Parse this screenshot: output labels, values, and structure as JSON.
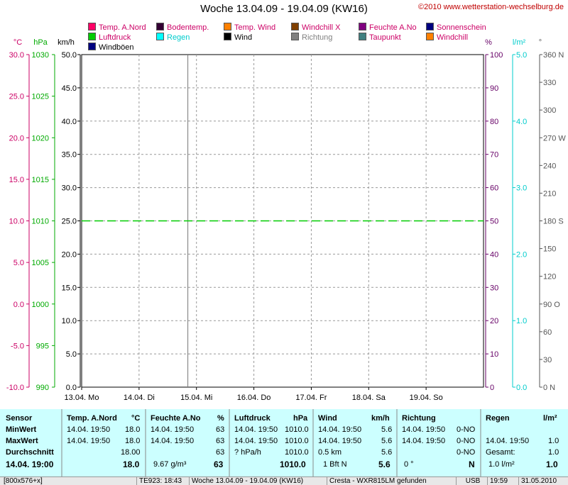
{
  "header": {
    "title": "Woche 13.04.09 - 19.04.09 (KW16)",
    "copyright": "©2010 www.wetterstation-wechselburg.de"
  },
  "legend": [
    {
      "label": "Temp. A.Nord",
      "color": "#ff0066",
      "text_color": "#cc0066"
    },
    {
      "label": "Bodentemp.",
      "color": "#330033",
      "text_color": "#cc0066"
    },
    {
      "label": "Temp. Wind",
      "color": "#ff8000",
      "text_color": "#cc0066"
    },
    {
      "label": "Windchill X",
      "color": "#804000",
      "text_color": "#cc0066"
    },
    {
      "label": "Feuchte A.No",
      "color": "#800080",
      "text_color": "#cc0066"
    },
    {
      "label": "Sonnenschein",
      "color": "#000080",
      "text_color": "#cc0066"
    },
    {
      "label": "Luftdruck",
      "color": "#00cc00",
      "text_color": "#cc0066"
    },
    {
      "label": "Regen",
      "color": "#00ffff",
      "text_color": "#00cccc"
    },
    {
      "label": "Wind",
      "color": "#000000",
      "text_color": "#000000"
    },
    {
      "label": "Richtung",
      "color": "#808080",
      "text_color": "#808080"
    },
    {
      "label": "Taupunkt",
      "color": "#408080",
      "text_color": "#cc0066"
    },
    {
      "label": "Windchill",
      "color": "#ff8000",
      "text_color": "#cc0066"
    },
    {
      "label": "Windböen",
      "color": "#000080",
      "text_color": "#000000"
    }
  ],
  "chart_data": {
    "type": "line",
    "x_ticks": [
      "13.04.  Mo",
      "14.04.  Di",
      "15.04.  Mi",
      "16.04.  Do",
      "17.04.  Fr",
      "18.04.  Sa",
      "19.04.  So"
    ],
    "axes": {
      "temp": {
        "unit": "°C",
        "min": -10,
        "max": 30,
        "ticks": [
          "-10.0",
          "-5.0",
          "0.0",
          "5.0",
          "10.0",
          "15.0",
          "20.0",
          "25.0",
          "30.0"
        ],
        "color": "#cc0066"
      },
      "pressure": {
        "unit": "hPa",
        "min": 990,
        "max": 1030,
        "ticks": [
          "990",
          "995",
          "1000",
          "1005",
          "1010",
          "1015",
          "1020",
          "1025",
          "1030"
        ],
        "color": "#00aa00"
      },
      "wind": {
        "unit": "km/h",
        "min": 0,
        "max": 50,
        "ticks": [
          "0.0",
          "5.0",
          "10.0",
          "15.0",
          "20.0",
          "25.0",
          "30.0",
          "35.0",
          "40.0",
          "45.0",
          "50.0"
        ],
        "color": "#000000"
      },
      "humidity": {
        "unit": "%",
        "min": 0,
        "max": 100,
        "ticks": [
          "0",
          "10",
          "20",
          "30",
          "40",
          "50",
          "60",
          "70",
          "80",
          "90",
          "100"
        ],
        "color": "#660066"
      },
      "rain": {
        "unit": "l/m²",
        "min": 0,
        "max": 5,
        "ticks": [
          "0.0",
          "1.0",
          "2.0",
          "3.0",
          "4.0",
          "5.0"
        ],
        "color": "#00cccc"
      },
      "direction": {
        "unit": "°",
        "min": 0,
        "max": 360,
        "ticks": [
          "0  N",
          "30",
          "60",
          "90  O",
          "120",
          "150",
          "180 S",
          "210",
          "240",
          "270 W",
          "300",
          "330",
          "360 N"
        ],
        "color": "#555555"
      }
    },
    "series": [
      {
        "name": "Luftdruck",
        "color": "#00cc00",
        "style": "dashed",
        "axis": "pressure",
        "values": [
          1010.0,
          1010.0
        ]
      }
    ],
    "now_marker_day": 1.85,
    "grid": true
  },
  "stats": {
    "sensor": {
      "header": "Sensor",
      "rows": [
        "MinWert",
        "MaxWert",
        "Durchschnitt",
        "14.04. 19:00"
      ]
    },
    "temp": {
      "header": "Temp. A.Nord",
      "unit": "°C",
      "min_time": "14.04.  19:50",
      "min": "18.0",
      "max_time": "14.04.  19:50",
      "max": "18.0",
      "avg": "18.00",
      "current": "18.0"
    },
    "humidity": {
      "header": "Feuchte A.No",
      "unit": "%",
      "min_time": "14.04.  19:50",
      "min": "63",
      "max_time": "14.04.  19:50",
      "max": "63",
      "avg": "63",
      "extra": "9.67 g/m³",
      "current": "63"
    },
    "pressure": {
      "header": "Luftdruck",
      "unit": "hPa",
      "min_time": "14.04.  19:50",
      "min": "1010.0",
      "max_time": "14.04.  19:50",
      "max": "1010.0",
      "trend": "? hPa/h",
      "avg": "1010.0",
      "current": "1010.0"
    },
    "wind": {
      "header": "Wind",
      "unit": "km/h",
      "min_time": "14.04.  19:50",
      "min": "5.6",
      "max_time": "14.04.  19:50",
      "max": "5.6",
      "dist": "0.5 km",
      "avg": "5.6",
      "bft": "1 Bft N",
      "current": "5.6"
    },
    "direction": {
      "header": "Richtung",
      "min_time": "14.04.  19:50",
      "min": "0-NO",
      "max_time": "14.04.  19:50",
      "max": "0-NO",
      "avg": "0-NO",
      "deg": "0 °",
      "current": "N"
    },
    "rain": {
      "header": "Regen",
      "unit": "l/m²",
      "min_time": "14.04.  19:50",
      "min": "1.0",
      "total_label": "Gesamt:",
      "total": "1.0",
      "daily": "1.0 l/m²",
      "current": "1.0"
    }
  },
  "statusbar": [
    "[800x576+x]",
    "TE923: 18:43",
    "Woche 13.04.09 - 19.04.09 (KW16)",
    "Cresta - WXR815LM gefunden",
    "USB",
    "19:59",
    "31.05.2010"
  ]
}
